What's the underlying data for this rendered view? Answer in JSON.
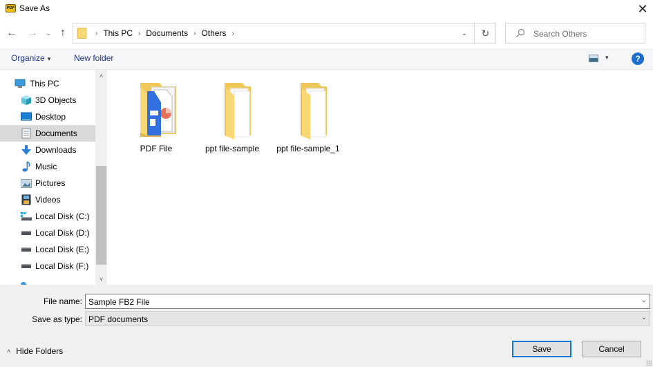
{
  "window": {
    "title": "Save As",
    "app_icon_label": "PDF",
    "close_glyph": "✕"
  },
  "nav": {
    "back_glyph": "←",
    "forward_glyph": "→",
    "recent_glyph": "⌄",
    "up_glyph": "↑",
    "breadcrumbs": [
      "This PC",
      "Documents",
      "Others"
    ],
    "separator_glyph": "›",
    "dropdown_glyph": "⌄",
    "refresh_glyph": "↻",
    "search_placeholder": "Search Others"
  },
  "toolbar": {
    "organize_label": "Organize",
    "organize_caret": "▾",
    "new_folder_label": "New folder",
    "view_caret": "▾",
    "help_glyph": "?"
  },
  "sidebar": {
    "items": [
      {
        "label": "This PC",
        "icon": "computer-icon",
        "level": 0,
        "selected": false
      },
      {
        "label": "3D Objects",
        "icon": "cube-icon",
        "level": 1,
        "selected": false
      },
      {
        "label": "Desktop",
        "icon": "desktop-icon",
        "level": 1,
        "selected": false
      },
      {
        "label": "Documents",
        "icon": "document-icon",
        "level": 1,
        "selected": true
      },
      {
        "label": "Downloads",
        "icon": "download-arrow-icon",
        "level": 1,
        "selected": false
      },
      {
        "label": "Music",
        "icon": "music-note-icon",
        "level": 1,
        "selected": false
      },
      {
        "label": "Pictures",
        "icon": "picture-icon",
        "level": 1,
        "selected": false
      },
      {
        "label": "Videos",
        "icon": "film-icon",
        "level": 1,
        "selected": false
      },
      {
        "label": "Local Disk (C:)",
        "icon": "system-drive-icon",
        "level": 1,
        "selected": false
      },
      {
        "label": "Local Disk (D:)",
        "icon": "drive-icon",
        "level": 1,
        "selected": false
      },
      {
        "label": "Local Disk (E:)",
        "icon": "drive-icon",
        "level": 1,
        "selected": false
      },
      {
        "label": "Local Disk (F:)",
        "icon": "drive-icon",
        "level": 1,
        "selected": false
      }
    ],
    "scroll_up_glyph": "˄",
    "scroll_down_glyph": "˅"
  },
  "content": {
    "items": [
      {
        "name": "PDF File",
        "type": "folder",
        "icon": "folder-with-pdf-icon"
      },
      {
        "name": "ppt file-sample",
        "type": "folder",
        "icon": "folder-icon"
      },
      {
        "name": "ppt file-sample_1",
        "type": "folder",
        "icon": "folder-icon"
      }
    ]
  },
  "form": {
    "file_name_label": "File name:",
    "file_name_value": "Sample FB2 File",
    "save_as_type_label": "Save as type:",
    "save_as_type_value": "PDF documents",
    "dropdown_glyph": "⌄"
  },
  "footer": {
    "hide_folders_glyph": "˄",
    "hide_folders_label": "Hide Folders",
    "save_label": "Save",
    "cancel_label": "Cancel"
  },
  "colors": {
    "accent": "#0078d7",
    "selection": "#d9d9d9",
    "link_text": "#1e3287",
    "help_blue": "#1a6fd1",
    "folder_yellow": "#f8d775"
  }
}
